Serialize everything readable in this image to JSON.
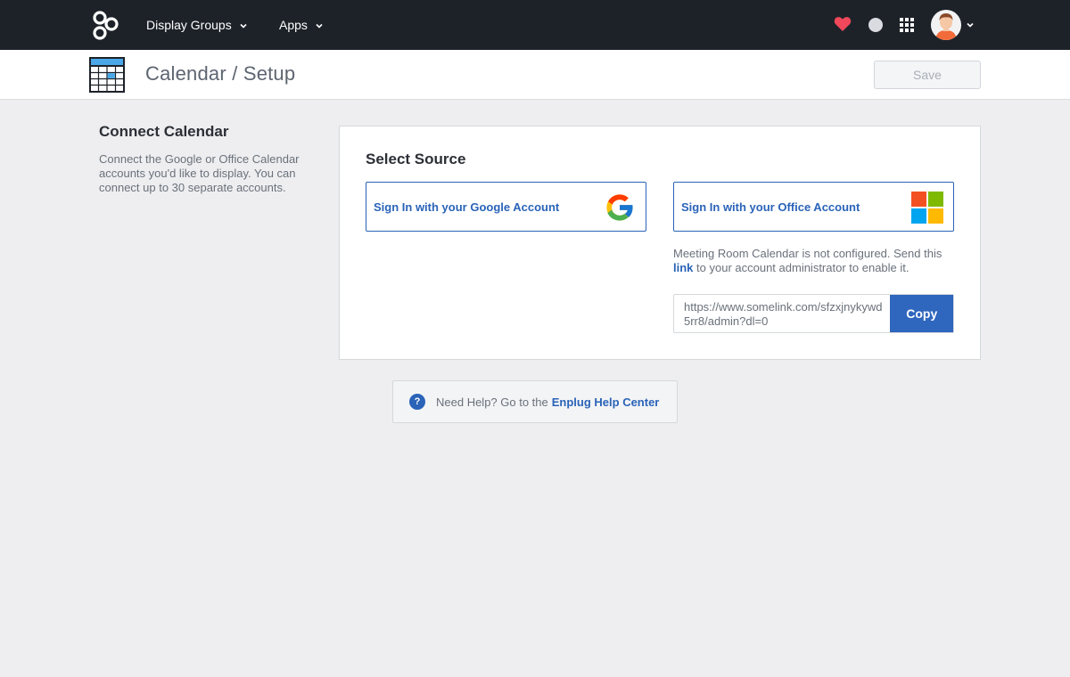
{
  "topbar": {
    "nav": [
      {
        "label": "Display Groups"
      },
      {
        "label": "Apps"
      }
    ],
    "icons": [
      "logo-icon",
      "heart-icon",
      "status-dot-icon",
      "apps-grid-icon",
      "avatar",
      "chevron-down-icon"
    ]
  },
  "header": {
    "title": "Calendar / Setup",
    "save_label": "Save"
  },
  "sidebar": {
    "title": "Connect Calendar",
    "description": "Connect the Google or Office Calendar accounts you'd like to display. You can connect up to 30 separate accounts."
  },
  "source": {
    "title": "Select Source",
    "google_label": "Sign In with your Google Account",
    "office_label": "Sign In with your Office Account",
    "notice_before": "Meeting Room Calendar is not configured.  Send this",
    "notice_link": "link",
    "notice_after": "to your account administrator to enable it.",
    "link_value": "https://www.somelink.com/sfzxjnykywd5rr8/admin?dl=0",
    "copy_label": "Copy"
  },
  "help": {
    "text": "Need Help? Go to the",
    "link": "Enplug Help Center"
  },
  "colors": {
    "topbar": "#1d2229",
    "accent": "#2a63b8",
    "background": "#eeeef0"
  }
}
